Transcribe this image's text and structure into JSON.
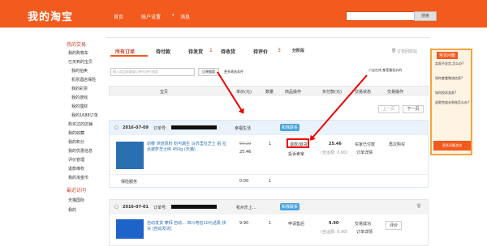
{
  "header": {
    "logo": "我的淘宝",
    "nav": [
      "首页",
      "账户设置",
      "消息"
    ],
    "search_btn": "搜索"
  },
  "sidebar": {
    "h1": "我的交易",
    "items1": [
      "我的购物车",
      "已买到的宝贝",
      "我的拍卖",
      "机票酒店保险",
      "我的彩票",
      "我的游戏",
      "我的理财",
      "我的1688订单",
      "购买过的店铺",
      "我的收藏",
      "我的积分",
      "我的优惠信息",
      "评价管理",
      "退款维权",
      "我的淘金币"
    ],
    "h2": "最近访问",
    "items2": [
      "天猫国际",
      "我的"
    ]
  },
  "tabs": {
    "all": "所有订单",
    "pay": "待付款",
    "ship": "待发货",
    "ship_n": "1",
    "recv": "待收货",
    "eval": "待评价",
    "eval_n": "3",
    "stage": "分阶段",
    "recycle": "订单回收站"
  },
  "search": {
    "placeholder": "输入商品标题或订单号进行搜索",
    "btn": "订单搜索",
    "more": "更多筛选条件",
    "hint": "小宝在线 都是最低价的"
  },
  "cols": {
    "item": "宝贝",
    "price": "单价(元)",
    "qty": "数量",
    "op": "商品操作",
    "paid": "实付款(元)",
    "status": "交易状态",
    "action": "交易操作"
  },
  "pager": {
    "prev": "上一页",
    "next": "下一页"
  },
  "order1": {
    "date": "2016-07-09",
    "no_label": "订单号:",
    "shop": "幸福生活",
    "contact": "和我联系",
    "title": "劲樱 烘焙原料 粉可蔬生 马苏里拉芝士 铝 拉丝披萨芝士碎 450g (天猫)",
    "price_old": "50.29",
    "price": "25.46",
    "qty": "1",
    "op1": "退款/退货",
    "op2": "投诉卖家",
    "paid": "25.46",
    "ship": "(含运费: 0.00)",
    "status1": "买家已付款",
    "status2": "订单详情",
    "action": "再次购买",
    "ins": "保险服务",
    "ins_price": "0.00",
    "ins_qty": "1"
  },
  "order2": {
    "date": "2016-07-01",
    "no_label": "订单号:",
    "shop": "杭州乐上...",
    "contact": "和我联系",
    "title": "自动发货 摩拜 自动... 四川电信10元话费 快充 [自动发货]",
    "price": "9.90",
    "qty": "1",
    "op": "申请售后",
    "paid": "9.90",
    "ship": "(含运费: 0.00)",
    "status1": "交易成功",
    "status2": "订单详情",
    "action": "评价"
  },
  "right": {
    "title": "常见问题",
    "q": [
      "卖家不发货,怎么办?",
      "如何查看物流信息?",
      "如何投诉卖家?",
      "退款完成未到账怎么办?"
    ],
    "more": "更多问题咨询"
  }
}
